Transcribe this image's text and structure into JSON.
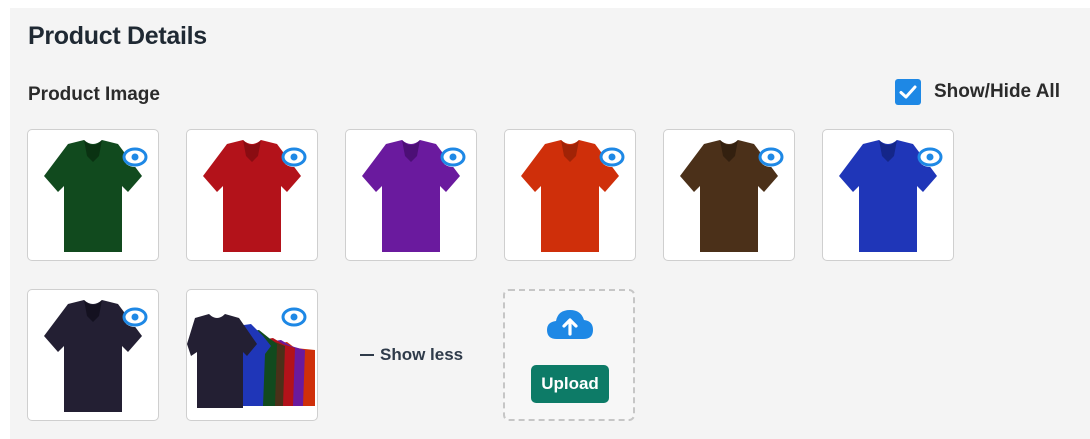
{
  "section": {
    "title": "Product Details"
  },
  "images_section": {
    "title": "Product Image",
    "show_hide_all_label": "Show/Hide All",
    "show_hide_all_checked": true,
    "show_less_label": "Show less",
    "upload_label": "Upload"
  },
  "images": [
    {
      "color_name": "green",
      "color": "#114a1e",
      "visible": true
    },
    {
      "color_name": "red",
      "color": "#b3121a",
      "visible": true
    },
    {
      "color_name": "purple",
      "color": "#6a1a9e",
      "visible": true
    },
    {
      "color_name": "orange-red",
      "color": "#cf2f0a",
      "visible": true
    },
    {
      "color_name": "brown",
      "color": "#4b3019",
      "visible": true
    },
    {
      "color_name": "blue",
      "color": "#1f36b8",
      "visible": true
    },
    {
      "color_name": "navy",
      "color": "#231f33",
      "visible": true
    },
    {
      "color_name": "multicolor",
      "color": "#231f33",
      "visible": true
    }
  ],
  "colors": {
    "panel_background": "#f4f4f4",
    "accent_blue": "#1e88e5",
    "upload_green": "#0d7b67"
  },
  "icons": {
    "eye": "eye-icon",
    "checkbox": "checkmark-icon",
    "upload": "cloud-upload-icon"
  }
}
